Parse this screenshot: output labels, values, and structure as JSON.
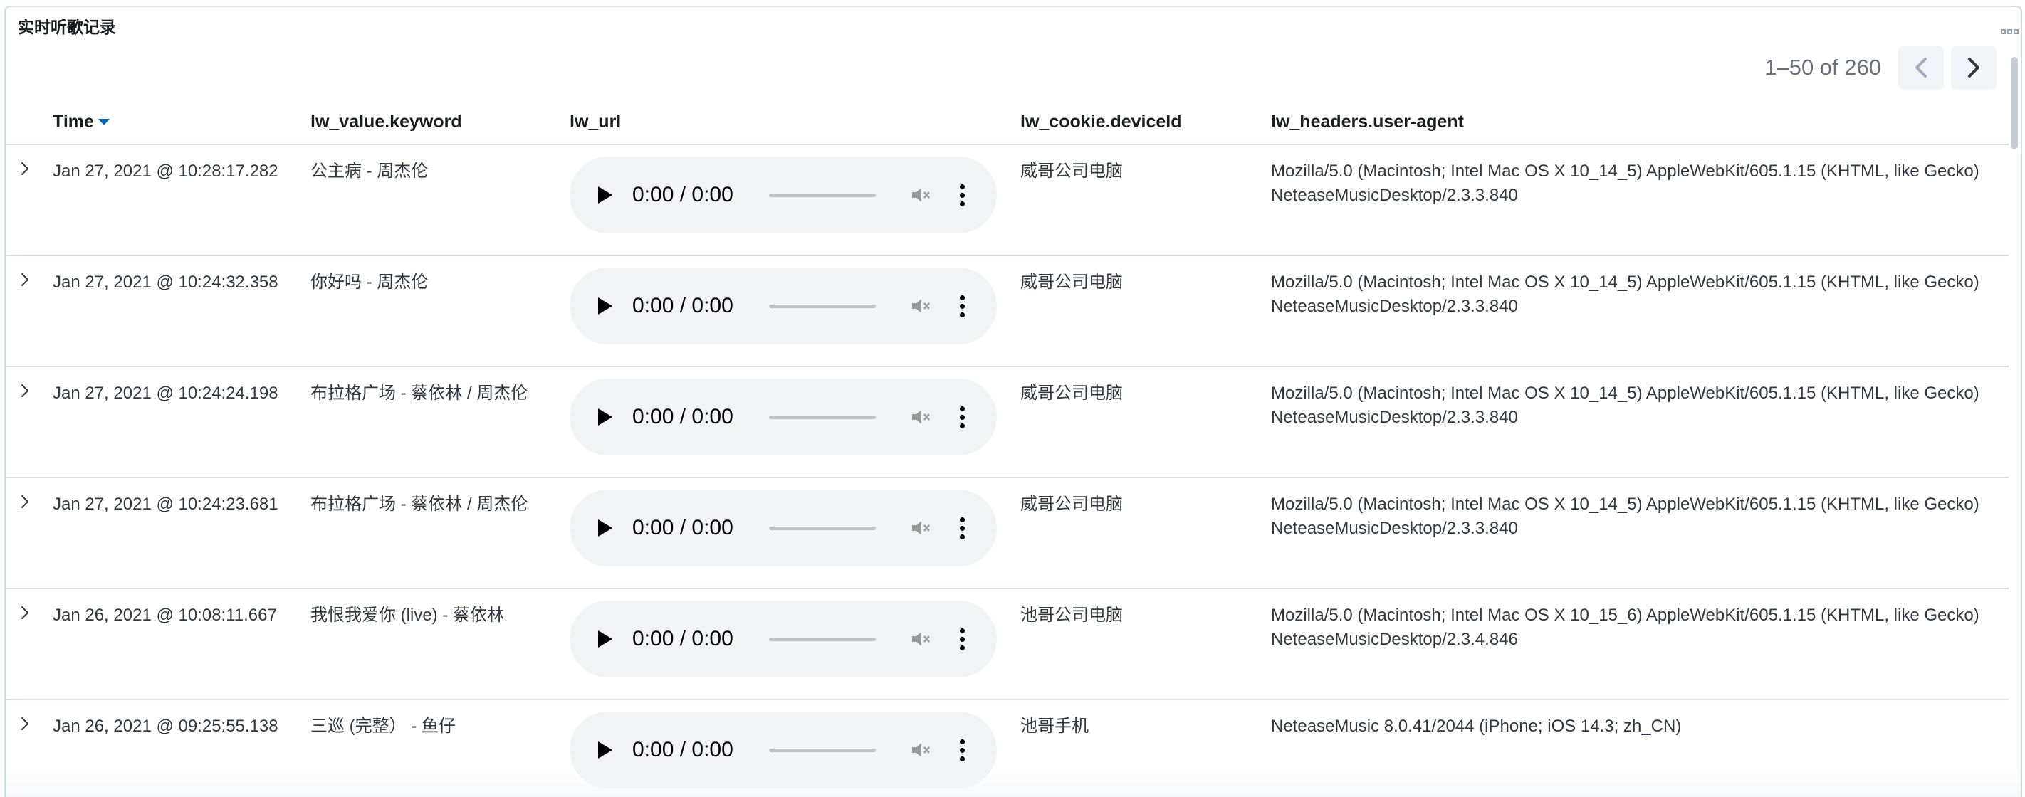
{
  "panel": {
    "title": "实时听歌记录"
  },
  "pagination": {
    "range_text": "1–50 of 260"
  },
  "table": {
    "columns": {
      "time": "Time",
      "keyword": "lw_value.keyword",
      "url": "lw_url",
      "device": "lw_cookie.deviceId",
      "user_agent": "lw_headers.user-agent"
    },
    "audio_time": "0:00 / 0:00",
    "rows": [
      {
        "time": "Jan 27, 2021 @ 10:28:17.282",
        "keyword": "公主病 - 周杰伦",
        "device": "威哥公司电脑",
        "user_agent": "Mozilla/5.0 (Macintosh; Intel Mac OS X 10_14_5) AppleWebKit/605.1.15 (KHTML, like Gecko) NeteaseMusicDesktop/2.3.3.840"
      },
      {
        "time": "Jan 27, 2021 @ 10:24:32.358",
        "keyword": "你好吗 - 周杰伦",
        "device": "威哥公司电脑",
        "user_agent": "Mozilla/5.0 (Macintosh; Intel Mac OS X 10_14_5) AppleWebKit/605.1.15 (KHTML, like Gecko) NeteaseMusicDesktop/2.3.3.840"
      },
      {
        "time": "Jan 27, 2021 @ 10:24:24.198",
        "keyword": "布拉格广场 - 蔡依林 / 周杰伦",
        "device": "威哥公司电脑",
        "user_agent": "Mozilla/5.0 (Macintosh; Intel Mac OS X 10_14_5) AppleWebKit/605.1.15 (KHTML, like Gecko) NeteaseMusicDesktop/2.3.3.840"
      },
      {
        "time": "Jan 27, 2021 @ 10:24:23.681",
        "keyword": "布拉格广场 - 蔡依林 / 周杰伦",
        "device": "威哥公司电脑",
        "user_agent": "Mozilla/5.0 (Macintosh; Intel Mac OS X 10_14_5) AppleWebKit/605.1.15 (KHTML, like Gecko) NeteaseMusicDesktop/2.3.3.840"
      },
      {
        "time": "Jan 26, 2021 @ 10:08:11.667",
        "keyword": "我恨我爱你 (live) - 蔡依林",
        "device": "池哥公司电脑",
        "user_agent": "Mozilla/5.0 (Macintosh; Intel Mac OS X 10_15_6) AppleWebKit/605.1.15 (KHTML, like Gecko) NeteaseMusicDesktop/2.3.4.846"
      },
      {
        "time": "Jan 26, 2021 @ 09:25:55.138",
        "keyword": "三巡 (完整） - 鱼仔",
        "device": "池哥手机",
        "user_agent": "NeteaseMusic 8.0.41/2044 (iPhone; iOS 14.3; zh_CN)"
      }
    ]
  }
}
